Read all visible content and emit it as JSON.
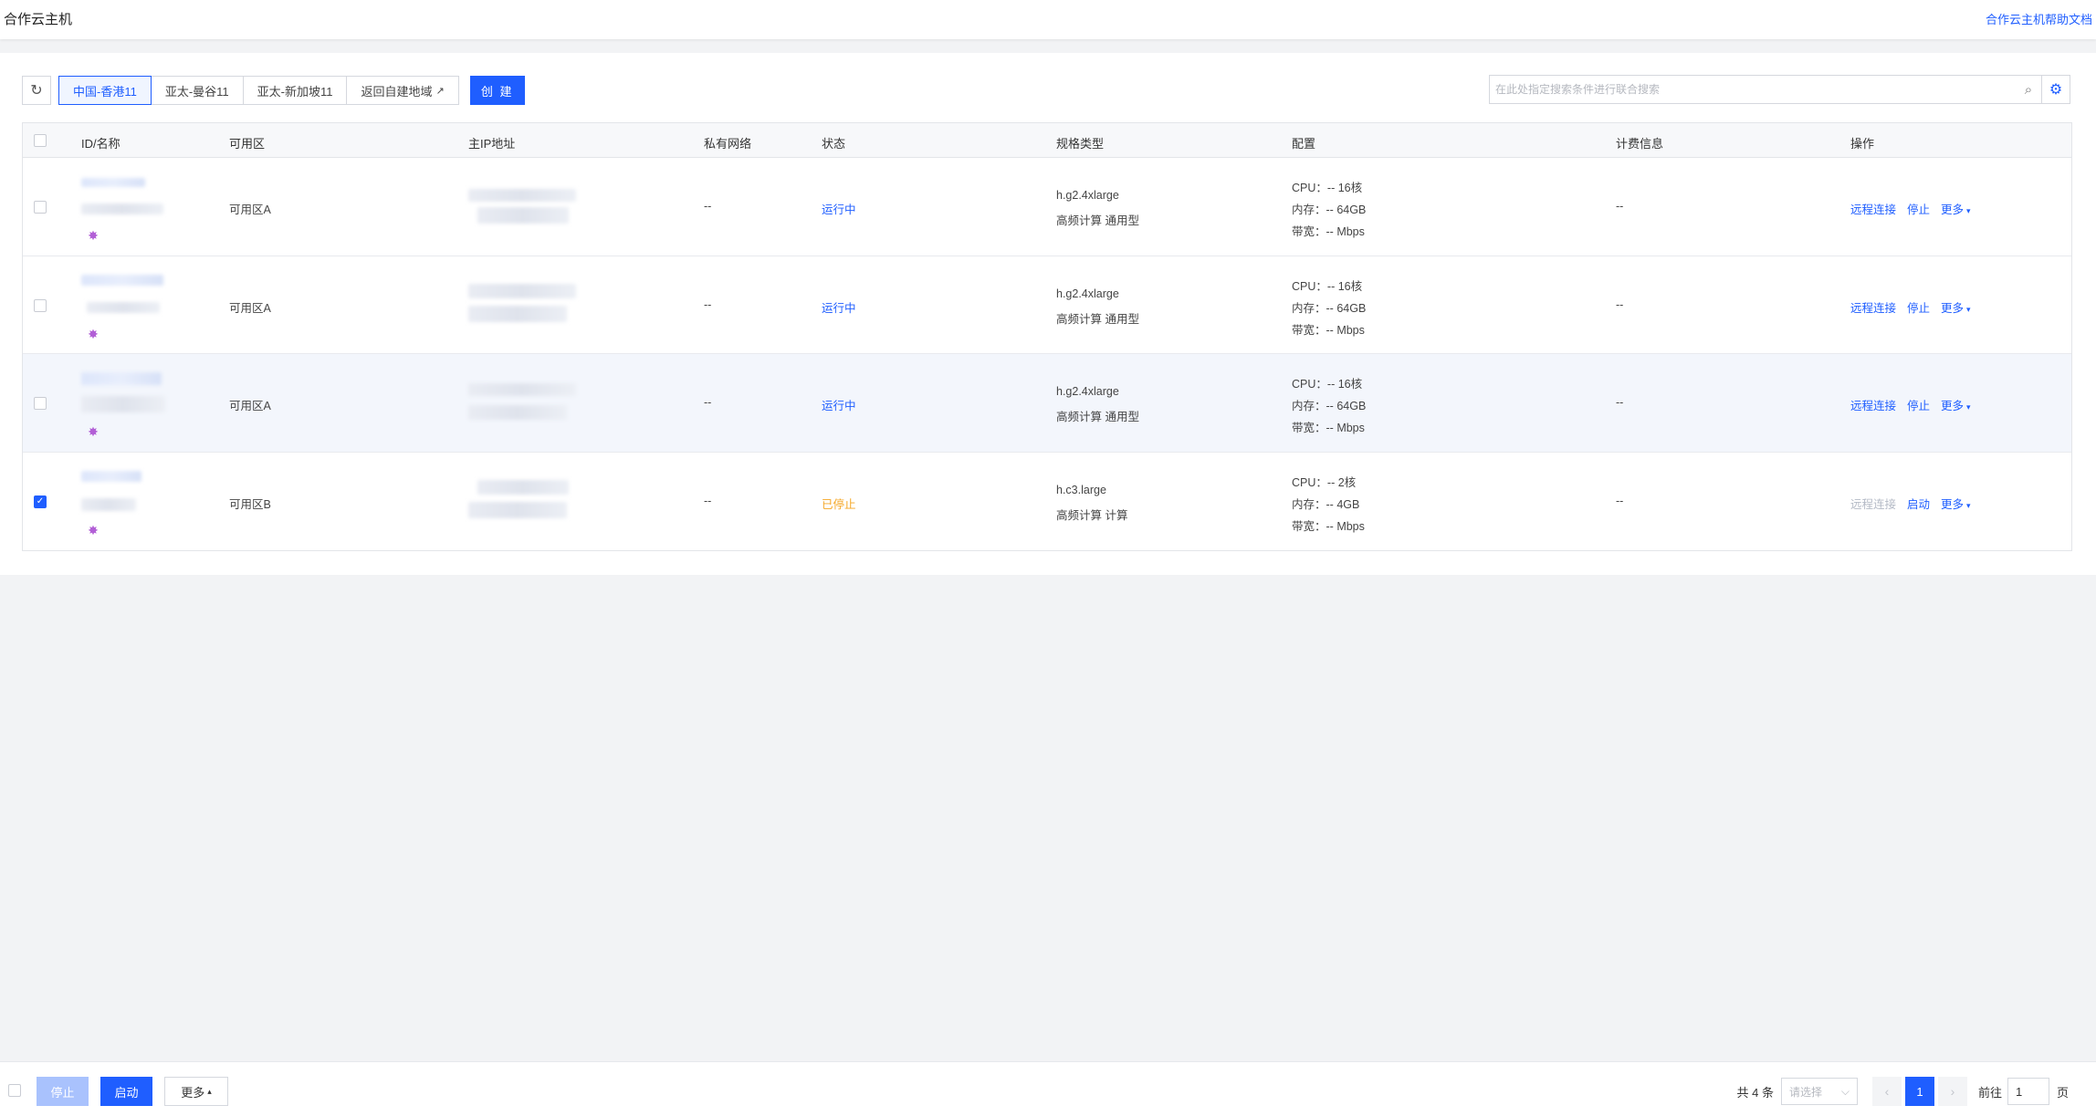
{
  "header": {
    "title": "合作云主机",
    "help_link": "合作云主机帮助文档"
  },
  "toolbar": {
    "regions": [
      {
        "label": "中国-香港11",
        "active": true
      },
      {
        "label": "亚太-曼谷11",
        "active": false
      },
      {
        "label": "亚太-新加坡11",
        "active": false
      },
      {
        "label": "返回自建地域",
        "active": false
      }
    ],
    "create_label": "创 建",
    "search_placeholder": "在此处指定搜索条件进行联合搜索"
  },
  "table": {
    "columns": [
      "ID/名称",
      "可用区",
      "主IP地址",
      "私有网络",
      "状态",
      "规格类型",
      "配置",
      "计费信息",
      "操作"
    ],
    "rows": [
      {
        "zone": "可用区A",
        "vpc": "--",
        "status": "运行中",
        "status_type": "running",
        "spec": "h.g2.4xlarge",
        "spec_desc": "高频计算 通用型",
        "cpu_label": "CPU：",
        "cpu": "-- 16核",
        "mem_label": "内存：",
        "mem": "-- 64GB",
        "bw_label": "带宽：",
        "bw": "-- Mbps",
        "billing": "--",
        "op_remote": "远程连接",
        "op_power": "停止",
        "op_more": "更多",
        "checked": false,
        "remote_disabled": false
      },
      {
        "zone": "可用区A",
        "vpc": "--",
        "status": "运行中",
        "status_type": "running",
        "spec": "h.g2.4xlarge",
        "spec_desc": "高频计算 通用型",
        "cpu_label": "CPU：",
        "cpu": "-- 16核",
        "mem_label": "内存：",
        "mem": "-- 64GB",
        "bw_label": "带宽：",
        "bw": "-- Mbps",
        "billing": "--",
        "op_remote": "远程连接",
        "op_power": "停止",
        "op_more": "更多",
        "checked": false,
        "remote_disabled": false
      },
      {
        "zone": "可用区A",
        "vpc": "--",
        "status": "运行中",
        "status_type": "running",
        "spec": "h.g2.4xlarge",
        "spec_desc": "高频计算 通用型",
        "cpu_label": "CPU：",
        "cpu": "-- 16核",
        "mem_label": "内存：",
        "mem": "-- 64GB",
        "bw_label": "带宽：",
        "bw": "-- Mbps",
        "billing": "--",
        "op_remote": "远程连接",
        "op_power": "停止",
        "op_more": "更多",
        "checked": false,
        "remote_disabled": false
      },
      {
        "zone": "可用区B",
        "vpc": "--",
        "status": "已停止",
        "status_type": "stopped",
        "spec": "h.c3.large",
        "spec_desc": "高频计算 计算",
        "cpu_label": "CPU：",
        "cpu": "-- 2核",
        "mem_label": "内存：",
        "mem": "-- 4GB",
        "bw_label": "带宽：",
        "bw": "-- Mbps",
        "billing": "--",
        "op_remote": "远程连接",
        "op_power": "启动",
        "op_more": "更多",
        "checked": true,
        "remote_disabled": true
      }
    ]
  },
  "footer": {
    "stop_label": "停止",
    "start_label": "启动",
    "more_label": "更多",
    "total": "共 4 条",
    "size_placeholder": "请选择",
    "current_page": "1",
    "goto_label": "前往",
    "goto_value": "1",
    "page_unit": "页"
  },
  "colors": {
    "primary": "#1f5eff",
    "stopped": "#f5a623"
  }
}
